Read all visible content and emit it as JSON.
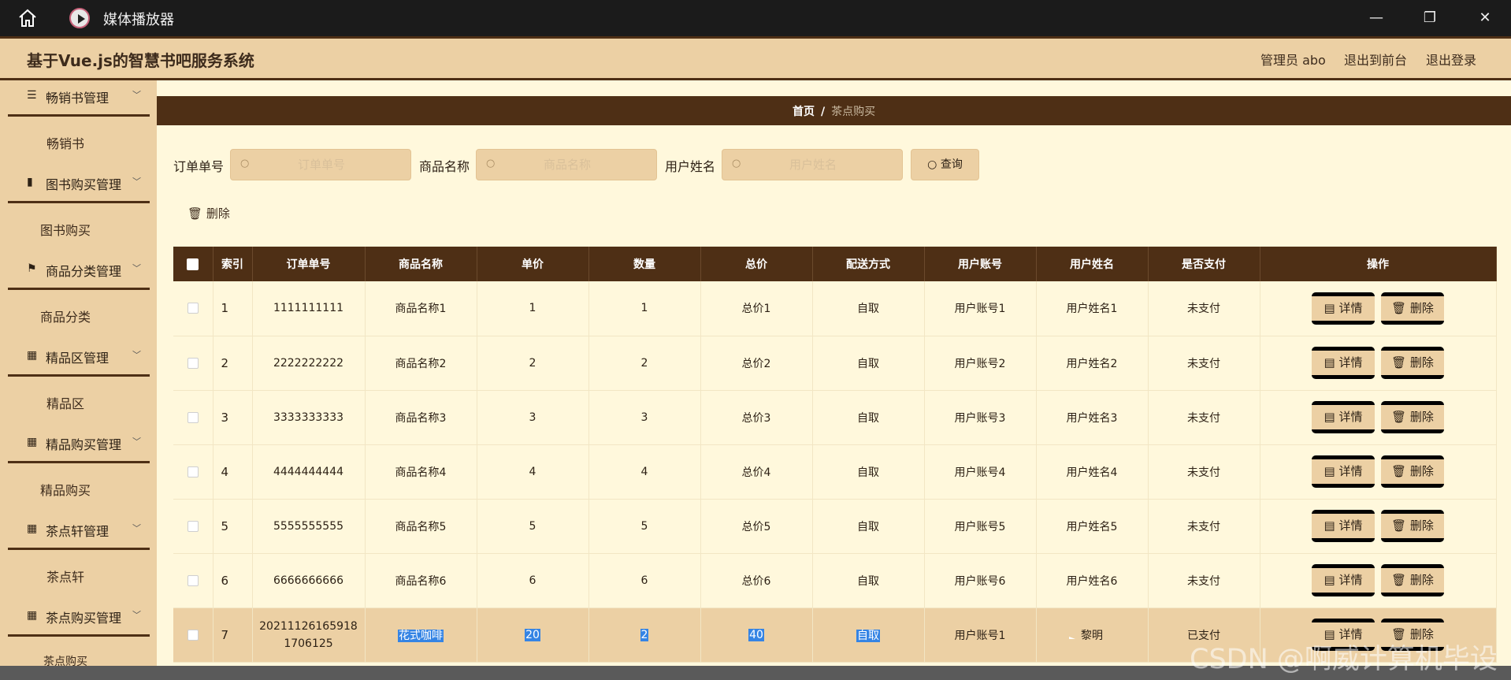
{
  "titlebar": {
    "title": "媒体播放器",
    "minimize": "—",
    "maximize": "❐",
    "close": "✕"
  },
  "header": {
    "title": "基于Vue.js的智慧书吧服务系统",
    "admin": "管理员 abo",
    "to_front": "退出到前台",
    "logout": "退出登录"
  },
  "sidebar": {
    "groups": [
      {
        "icon": "☰",
        "label": "畅销书管理",
        "sub": "畅销书"
      },
      {
        "icon": "▮",
        "label": "图书购买管理",
        "sub": "图书购买"
      },
      {
        "icon": "⚑",
        "label": "商品分类管理",
        "sub": "商品分类"
      },
      {
        "icon": "▦",
        "label": "精品区管理",
        "sub": "精品区"
      },
      {
        "icon": "▦",
        "label": "精品购买管理",
        "sub": "精品购买"
      },
      {
        "icon": "▦",
        "label": "茶点轩管理",
        "sub": "茶点轩"
      },
      {
        "icon": "▦",
        "label": "茶点购买管理",
        "sub": "茶点购买"
      }
    ]
  },
  "breadcrumb": {
    "home": "首页",
    "sep": "/",
    "current": "茶点购买"
  },
  "search": {
    "order_label": "订单单号",
    "order_placeholder": "订单单号",
    "product_label": "商品名称",
    "product_placeholder": "商品名称",
    "user_label": "用户姓名",
    "user_placeholder": "用户姓名",
    "button": "查询"
  },
  "toolbar": {
    "delete": "删除"
  },
  "table": {
    "headers": [
      "索引",
      "订单单号",
      "商品名称",
      "单价",
      "数量",
      "总价",
      "配送方式",
      "用户账号",
      "用户姓名",
      "是否支付",
      "操作"
    ],
    "detail_label": "详情",
    "delete_label": "删除",
    "rows": [
      {
        "index": "1",
        "order": "1111111111",
        "product": "商品名称1",
        "price": "1",
        "qty": "1",
        "total": "总价1",
        "delivery": "自取",
        "account": "用户账号1",
        "name": "用户姓名1",
        "paid": "未支付"
      },
      {
        "index": "2",
        "order": "2222222222",
        "product": "商品名称2",
        "price": "2",
        "qty": "2",
        "total": "总价2",
        "delivery": "自取",
        "account": "用户账号2",
        "name": "用户姓名2",
        "paid": "未支付"
      },
      {
        "index": "3",
        "order": "3333333333",
        "product": "商品名称3",
        "price": "3",
        "qty": "3",
        "total": "总价3",
        "delivery": "自取",
        "account": "用户账号3",
        "name": "用户姓名3",
        "paid": "未支付"
      },
      {
        "index": "4",
        "order": "4444444444",
        "product": "商品名称4",
        "price": "4",
        "qty": "4",
        "total": "总价4",
        "delivery": "自取",
        "account": "用户账号4",
        "name": "用户姓名4",
        "paid": "未支付"
      },
      {
        "index": "5",
        "order": "5555555555",
        "product": "商品名称5",
        "price": "5",
        "qty": "5",
        "total": "总价5",
        "delivery": "自取",
        "account": "用户账号5",
        "name": "用户姓名5",
        "paid": "未支付"
      },
      {
        "index": "6",
        "order": "6666666666",
        "product": "商品名称6",
        "price": "6",
        "qty": "6",
        "total": "总价6",
        "delivery": "自取",
        "account": "用户账号6",
        "name": "用户姓名6",
        "paid": "未支付"
      },
      {
        "index": "7",
        "order_line1": "20211126165918",
        "order_line2": "1706125",
        "product": "花式咖啡",
        "price": "20",
        "qty": "2",
        "total": "40",
        "delivery": "自取",
        "account": "用户账号1",
        "name": "黎明",
        "paid": "已支付"
      }
    ]
  },
  "watermark": "CSDN @啊威计算机毕设"
}
